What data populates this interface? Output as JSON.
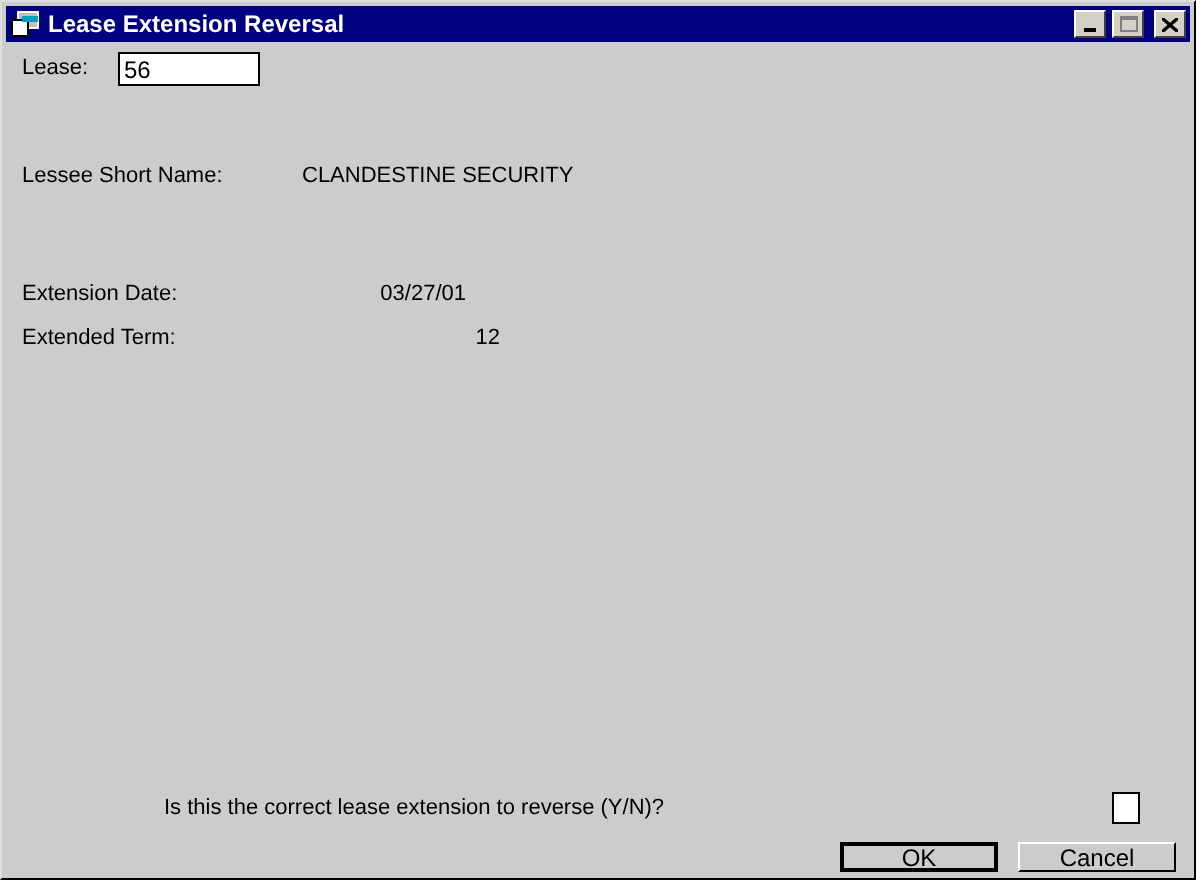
{
  "window": {
    "title": "Lease Extension Reversal"
  },
  "lease": {
    "label": "Lease:",
    "value": "56"
  },
  "lessee": {
    "label": "Lessee Short Name:",
    "value": "CLANDESTINE SECURITY"
  },
  "extension_date": {
    "label": "Extension Date:",
    "value": "03/27/01"
  },
  "extended_term": {
    "label": "Extended Term:",
    "value": "12"
  },
  "confirm": {
    "label": "Is this the correct lease extension to reverse (Y/N)?"
  },
  "buttons": [
    {
      "label": "OK",
      "default": true
    },
    {
      "label": "Cancel",
      "default": false
    }
  ]
}
